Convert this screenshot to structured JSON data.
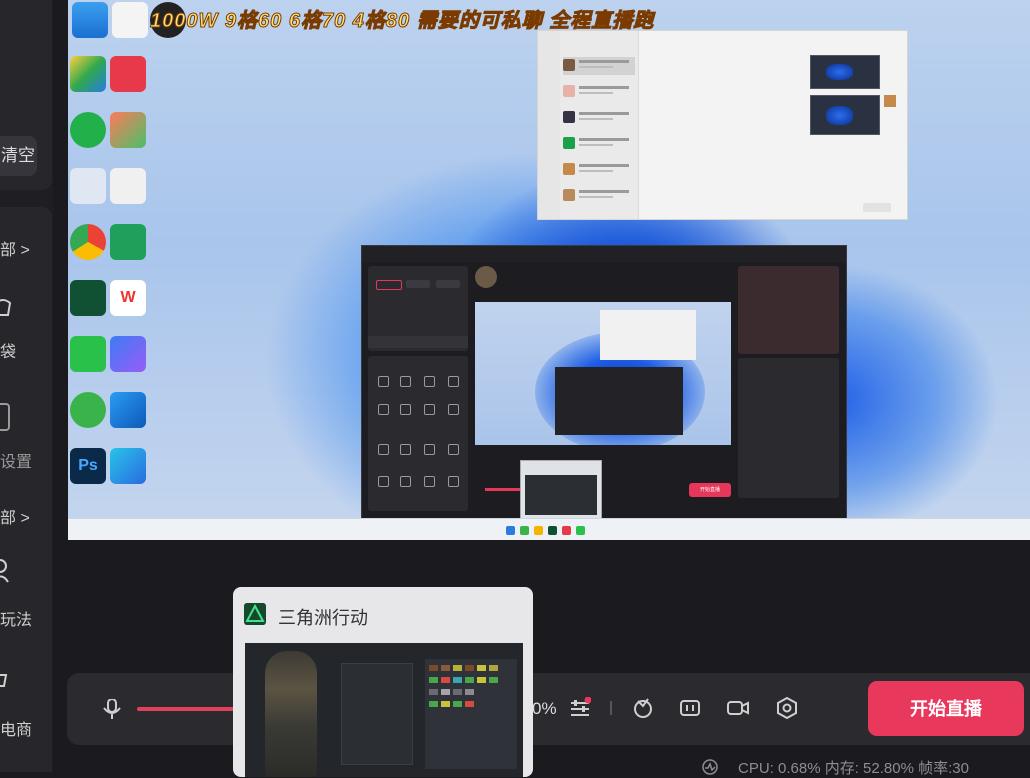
{
  "sidebar": {
    "clear_label": "清空",
    "all_label_1": "部 >",
    "bag_label": "袋",
    "settings_label": "设置",
    "all_label_2": "部 >",
    "gameplay_label": "玩法",
    "ecommerce_label": "电商"
  },
  "preview": {
    "banner_text": "1000W  9格60  6格70  4格80  需要的可私聊  全程直播跑",
    "desktop_icons": [
      "此电脑",
      "回收站",
      "Chrome",
      "WPS",
      "微信",
      "AI",
      "Edge",
      "Ps"
    ],
    "studio_start_label": "开始直播"
  },
  "popup": {
    "game_title": "三角洲行动"
  },
  "controls": {
    "percent": "0%",
    "start_live_label": "开始直播"
  },
  "status": {
    "stats_text": "CPU: 0.68%   内存: 52.80%   帧率:30"
  },
  "colors": {
    "accent": "#e8385c",
    "panel": "#2a2a2f",
    "background": "#1b1b1f"
  }
}
